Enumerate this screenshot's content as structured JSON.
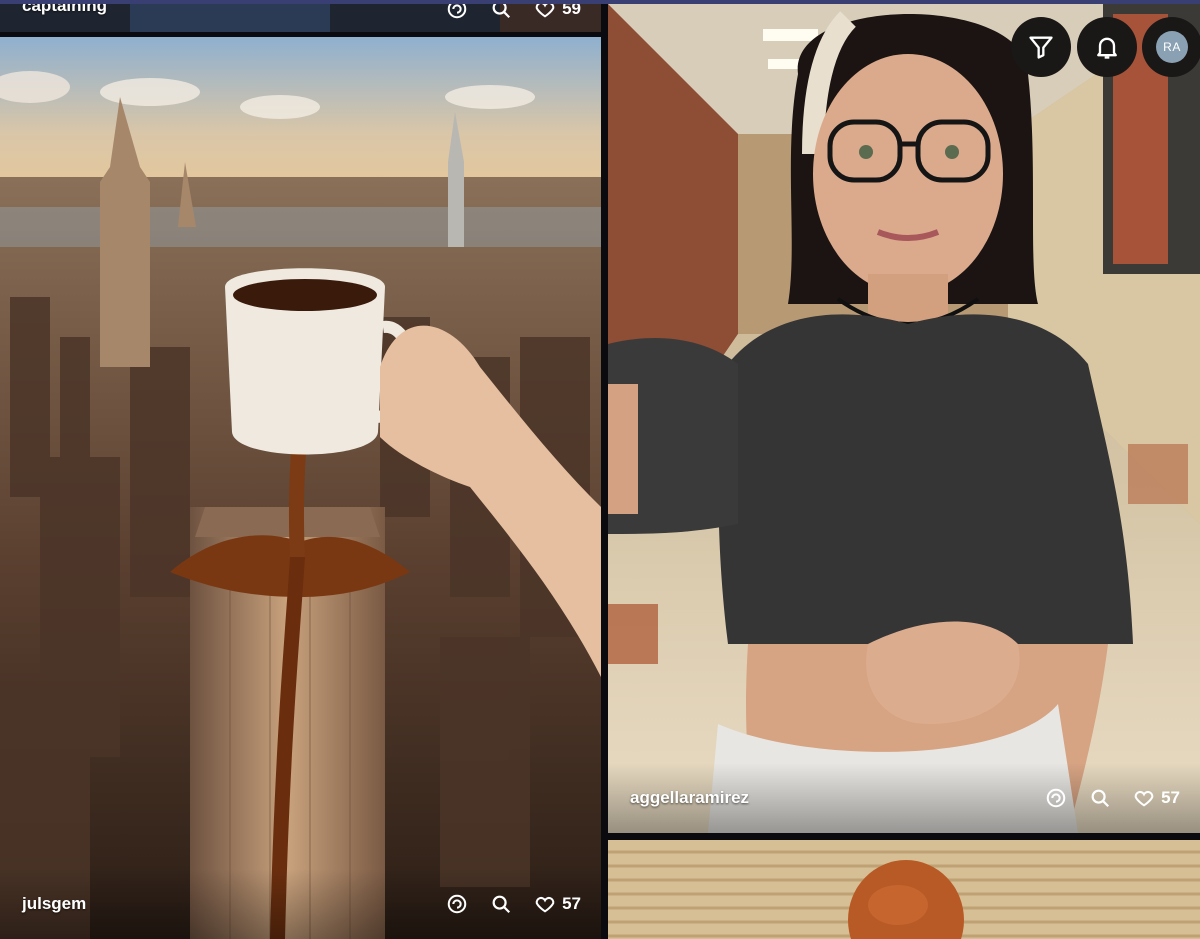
{
  "posts": [
    {
      "username": "captaining",
      "likes": "59"
    },
    {
      "username": "julsgem",
      "likes": "57"
    },
    {
      "username": "aggellaramirez",
      "likes": "57"
    }
  ],
  "controls": {
    "avatar_initials": "RA"
  },
  "icons": {
    "remix": "remix-icon",
    "search": "search-icon",
    "heart": "heart-icon",
    "filter": "filter-icon",
    "bell": "bell-icon"
  }
}
